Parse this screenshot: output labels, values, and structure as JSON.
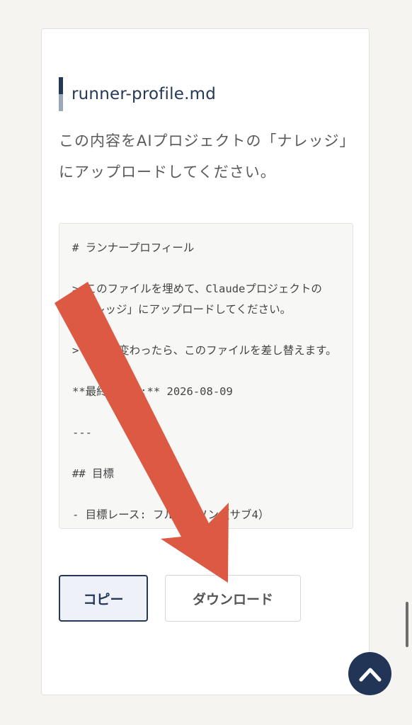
{
  "file": {
    "name": "runner-profile.md",
    "instruction": "この内容をAIプロジェクトの「ナレッジ」にアップロードしてください。"
  },
  "code": {
    "lines": [
      "# ランナープロフィール",
      "",
      "> このファイルを埋めて、Claudeプロジェクトの「ナレッジ」にアップロードしてください。",
      "",
      "> 情報が変わったら、このファイルを差し替えます。",
      "",
      "**最終更新日:** 2026-08-09",
      "",
      "---",
      "",
      "## 目標",
      "",
      "- 目標レース: フルマラソン（サブ4）"
    ]
  },
  "buttons": {
    "copy_label": "コピー",
    "download_label": "ダウンロード"
  },
  "colors": {
    "accent": "#243858",
    "arrow": "#dc5a43"
  },
  "icons": {
    "back_to_top": "chevron-up-icon"
  }
}
